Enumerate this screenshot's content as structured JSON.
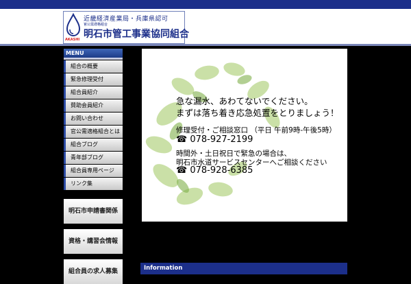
{
  "header": {
    "logo_line1": "近畿経済産業局・兵庫県認可",
    "logo_line2": "官公需適格組合",
    "logo_line3": "明石市管工事業協同組合",
    "logo_akashi": "AKASHI"
  },
  "sidebar": {
    "menu_title": "MENU",
    "items": [
      {
        "label": "組合の概要"
      },
      {
        "label": "緊急修理受付"
      },
      {
        "label": "組合員紹介"
      },
      {
        "label": "賛助会員紹介"
      },
      {
        "label": "お問い合わせ"
      },
      {
        "label": "官公需適格組合とは"
      },
      {
        "label": "組合ブログ"
      },
      {
        "label": "青年部ブログ"
      },
      {
        "label": "組合員専用ページ"
      },
      {
        "label": "リンク集"
      }
    ]
  },
  "banners": [
    {
      "label": "明石市申請書関係"
    },
    {
      "label": "資格・講習会情報"
    },
    {
      "label": "組合員の求人募集"
    }
  ],
  "hero": {
    "line1": "急な漏水、あわてないでください。",
    "line2": "まずは落ち着き応急処置をとりましょう！",
    "line3": "修理受付・ご相談窓口 （平日 午前9時-午後5時）",
    "phone1": "☎ 078-927-2199",
    "line4": "時間外・土日祝日で緊急の場合は、",
    "line5": "明石市水道サービスセンターへご相談ください",
    "phone2": "☎ 078-928-6385"
  },
  "info": {
    "title": "Information"
  },
  "colors": {
    "brand_blue": "#1c2f8a",
    "accent_red": "#d81c1c"
  }
}
